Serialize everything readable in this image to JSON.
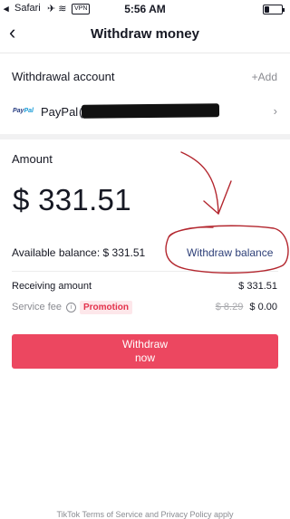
{
  "status_bar": {
    "back_app": "◂",
    "carrier": "Safari",
    "icons": "✈ ≋",
    "vpn": "VPN",
    "time": "5:56 AM"
  },
  "nav": {
    "back_icon": "‹",
    "title": "Withdraw money"
  },
  "withdrawal_account": {
    "label": "Withdrawal account",
    "add_label": "+Add",
    "method_logo": "PayPal",
    "method_name": "PayPal",
    "account_prefix": "(",
    "chevron": "›"
  },
  "amount": {
    "label": "Amount",
    "value": "$ 331.51"
  },
  "balance": {
    "available_text": "Available balance: $ 331.51",
    "withdraw_balance_link": "Withdraw balance"
  },
  "summary": {
    "receiving_label": "Receiving amount",
    "receiving_value": "$ 331.51",
    "service_fee_label": "Service fee",
    "info_icon": "i",
    "promotion_badge": "Promotion",
    "original_fee": "$ 8.29",
    "final_fee": "$ 0.00"
  },
  "withdraw_button": {
    "label": "Withdraw now"
  },
  "footer": {
    "text": "TikTok Terms of Service and Privacy Policy apply"
  },
  "colors": {
    "accent": "#ec4760",
    "link": "#2d3f78",
    "annotation": "#b3262e"
  }
}
